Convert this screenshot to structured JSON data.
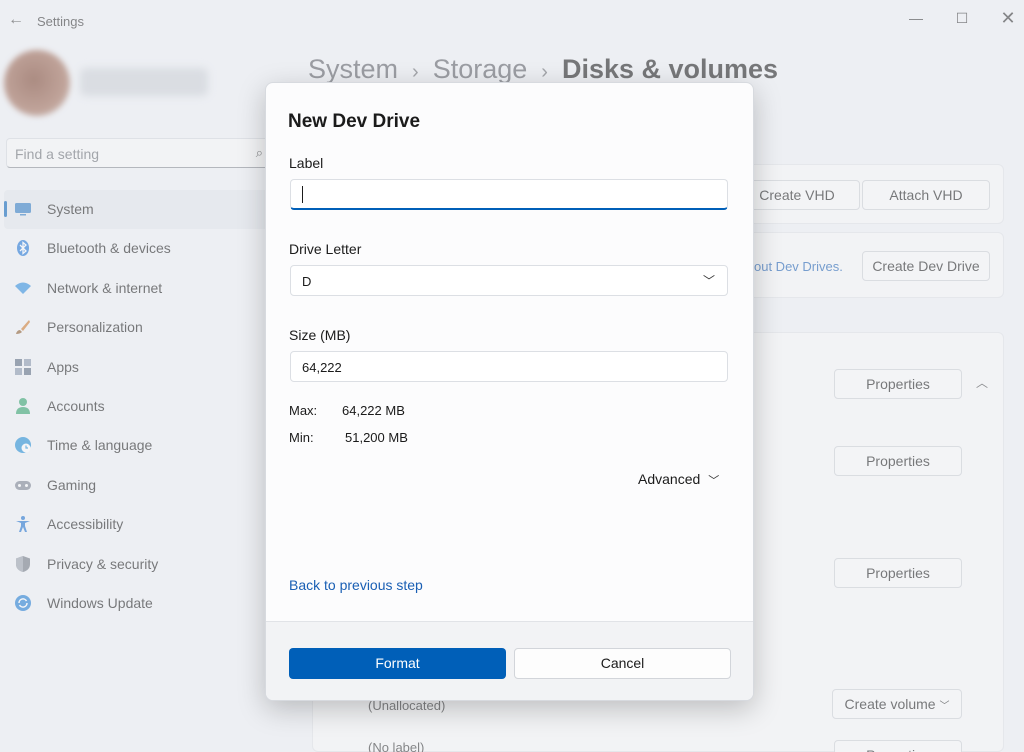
{
  "window": {
    "title": "Settings",
    "back_icon": "←",
    "minimize_icon": "—",
    "maximize_icon": "☐",
    "close_icon": "✕"
  },
  "search": {
    "placeholder": "Find a setting",
    "icon": "⌕"
  },
  "sidebar": {
    "items": [
      {
        "label": "System",
        "icon": "monitor-icon",
        "color": "#2a79c4",
        "active": true
      },
      {
        "label": "Bluetooth & devices",
        "icon": "bluetooth-icon",
        "color": "#1a73d8"
      },
      {
        "label": "Network & internet",
        "icon": "wifi-icon",
        "color": "#2b8ce0"
      },
      {
        "label": "Personalization",
        "icon": "brush-icon",
        "color": "#d07a2c"
      },
      {
        "label": "Apps",
        "icon": "apps-icon",
        "color": "#5a6a80"
      },
      {
        "label": "Accounts",
        "icon": "person-icon",
        "color": "#2fa36b"
      },
      {
        "label": "Time & language",
        "icon": "globe-clock-icon",
        "color": "#1b8bd6"
      },
      {
        "label": "Gaming",
        "icon": "controller-icon",
        "color": "#7a8290"
      },
      {
        "label": "Accessibility",
        "icon": "accessibility-icon",
        "color": "#1b6fd0"
      },
      {
        "label": "Privacy & security",
        "icon": "shield-icon",
        "color": "#6f7782"
      },
      {
        "label": "Windows Update",
        "icon": "update-icon",
        "color": "#1b7ad4"
      }
    ]
  },
  "breadcrumb": {
    "first": "System",
    "second": "Storage",
    "current": "Disks & volumes",
    "separator": "›"
  },
  "background": {
    "create_vhd": "Create VHD",
    "attach_vhd": "Attach VHD",
    "dev_drive_link": "out Dev Drives.",
    "create_dev_drive": "Create Dev Drive",
    "properties": "Properties",
    "unallocated": "(Unallocated)",
    "create_volume": "Create volume",
    "no_label": "(No label)",
    "chevron_up": "︿",
    "chevron_down": "﹀"
  },
  "dialog": {
    "title": "New Dev Drive",
    "label_field": {
      "label": "Label",
      "value": ""
    },
    "drive_letter": {
      "label": "Drive Letter",
      "value": "D"
    },
    "size": {
      "label": "Size (MB)",
      "value": "64,222"
    },
    "max": {
      "key": "Max:",
      "value": "64,222 MB"
    },
    "min": {
      "key": "Min:",
      "value": "51,200 MB"
    },
    "advanced": "Advanced",
    "back_link": "Back to previous step",
    "format_button": "Format",
    "cancel_button": "Cancel"
  }
}
